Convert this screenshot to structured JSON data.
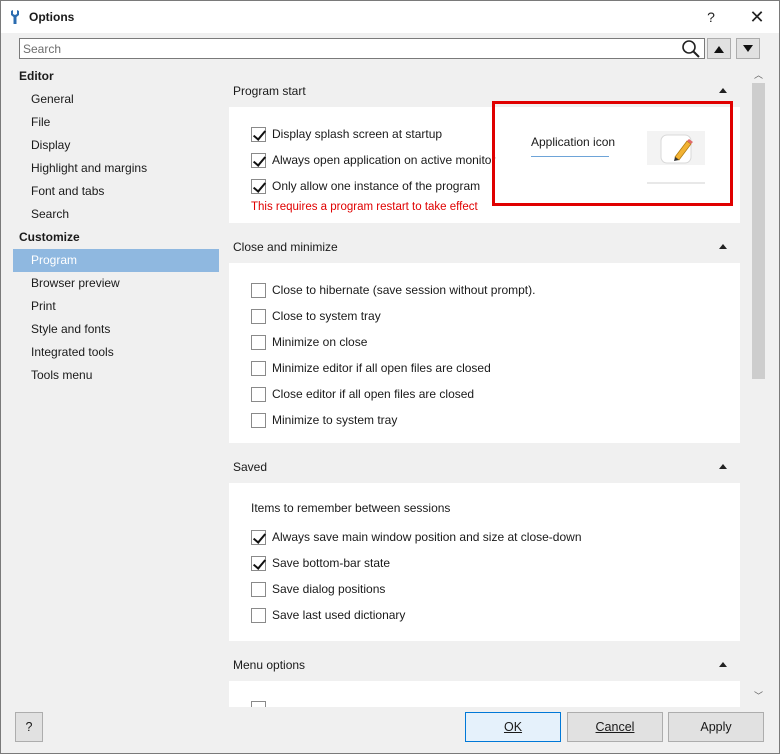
{
  "window": {
    "title": "Options",
    "help_glyph": "?",
    "close_glyph": "✕"
  },
  "search": {
    "placeholder": "Search"
  },
  "tree": {
    "editor_group": "Editor",
    "editor_items": [
      "General",
      "File",
      "Display",
      "Highlight and margins",
      "Font and tabs",
      "Search"
    ],
    "customize_group": "Customize",
    "customize_items": [
      "Program",
      "Browser preview",
      "Print",
      "Style and fonts",
      "Integrated tools",
      "Tools menu"
    ],
    "selected": "Program"
  },
  "sections": {
    "program_start": {
      "title": "Program start",
      "options": [
        {
          "label": "Display splash screen at startup",
          "checked": true
        },
        {
          "label": "Always open application on active monitor",
          "checked": true
        },
        {
          "label": "Only allow one instance of the program",
          "checked": true
        }
      ],
      "restart_note": "This requires a program restart to take effect",
      "app_icon_label": "Application icon"
    },
    "close_minimize": {
      "title": "Close and minimize",
      "options": [
        {
          "label": "Close to hibernate (save session without prompt).",
          "checked": false
        },
        {
          "label": "Close to system tray",
          "checked": false
        },
        {
          "label": "Minimize on close",
          "checked": false
        },
        {
          "label": "Minimize editor if all open files are closed",
          "checked": false
        },
        {
          "label": "Close editor if all open files are closed",
          "checked": false
        },
        {
          "label": "Minimize to system tray",
          "checked": false
        }
      ]
    },
    "saved": {
      "title": "Saved",
      "intro": "Items to remember between sessions",
      "options": [
        {
          "label": "Always save main window position and size at close-down",
          "checked": true
        },
        {
          "label": "Save bottom-bar state",
          "checked": true
        },
        {
          "label": "Save dialog positions",
          "checked": false
        },
        {
          "label": "Save last used dictionary",
          "checked": false
        }
      ]
    },
    "menu_options": {
      "title": "Menu options"
    }
  },
  "buttons": {
    "help": "?",
    "ok": "OK",
    "cancel": "Cancel",
    "apply": "Apply"
  },
  "colors": {
    "highlight_frame": "#e00000",
    "selection": "#8fb8e0",
    "note": "#e00000"
  }
}
